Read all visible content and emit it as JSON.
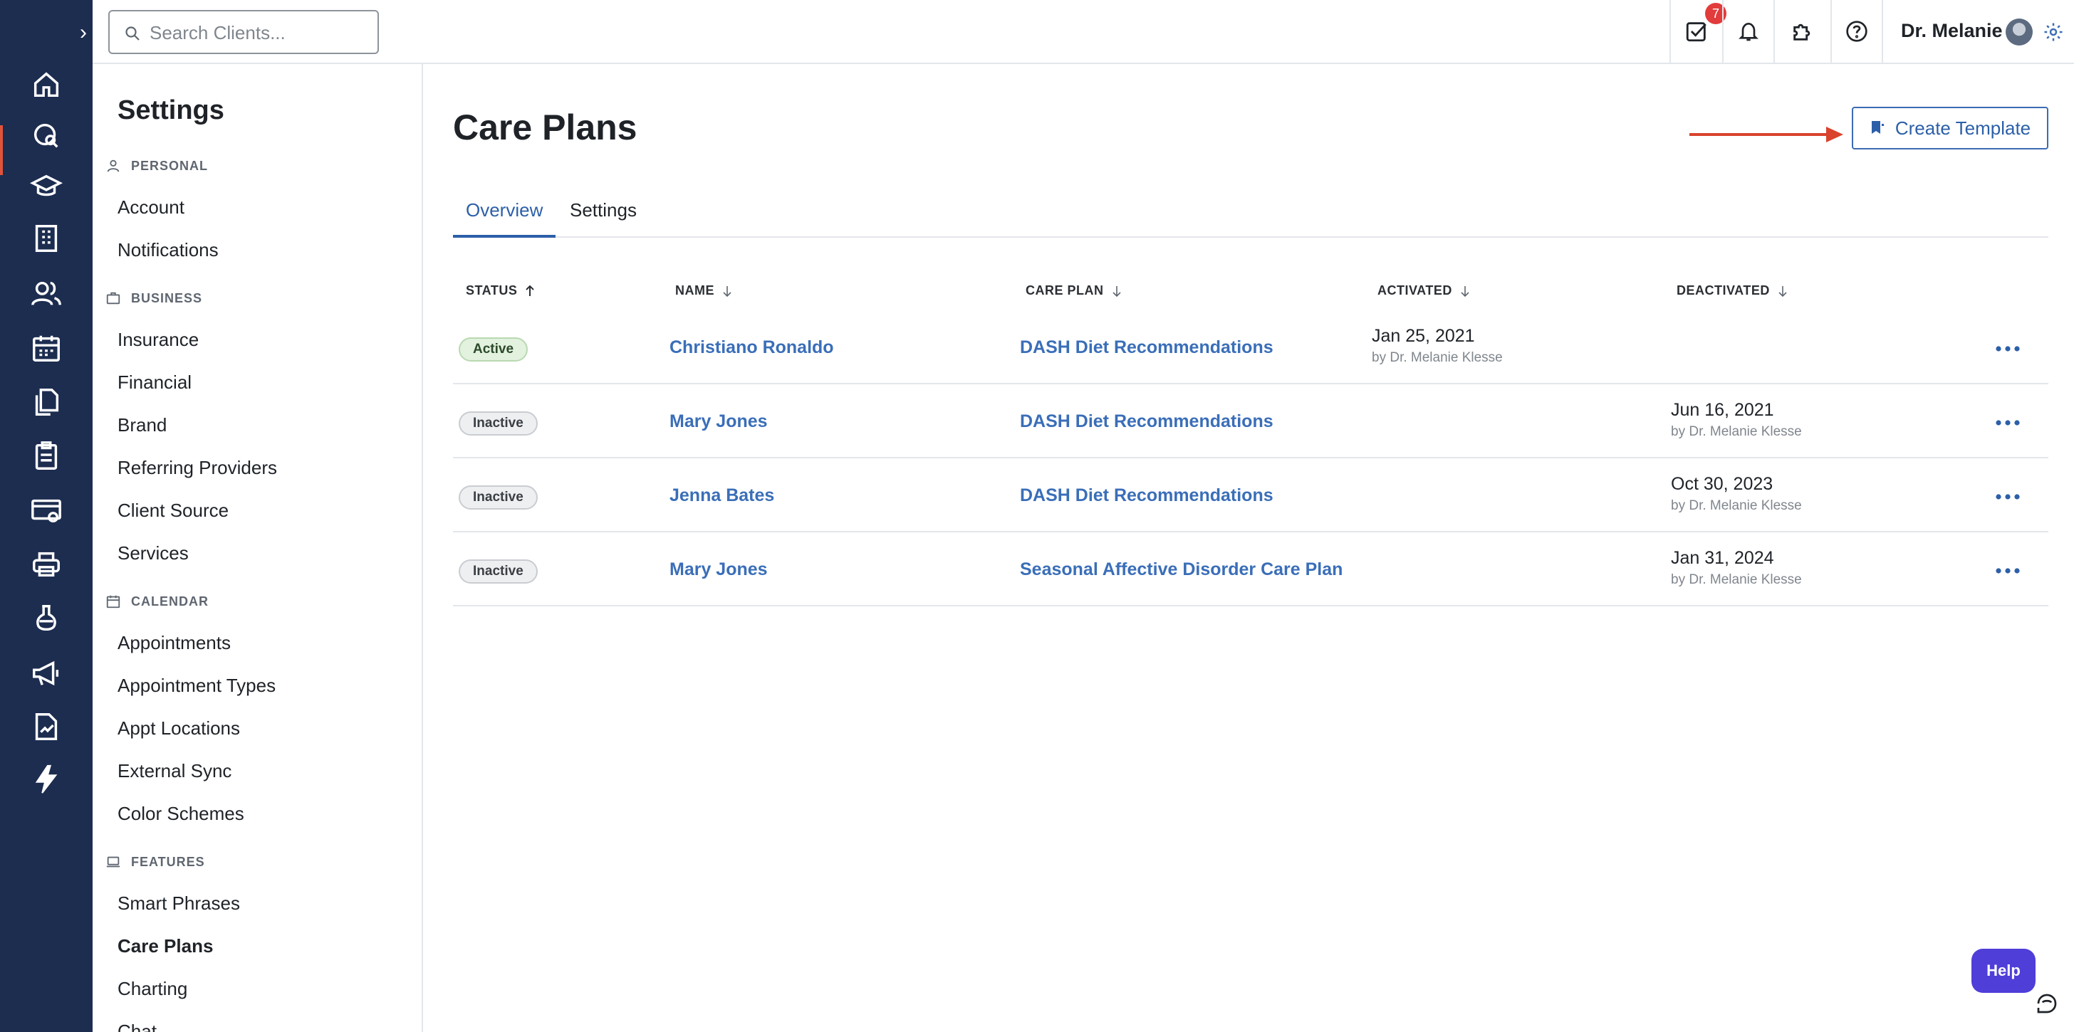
{
  "search": {
    "placeholder": "Search Clients..."
  },
  "topbar": {
    "task_badge_count": "7",
    "user_name": "Dr. Melanie"
  },
  "rail": {
    "icons": [
      "home-icon",
      "chat-search-icon",
      "education-icon",
      "building-icon",
      "clients-icon",
      "calendar-icon",
      "documents-icon",
      "clipboard-icon",
      "billing-icon",
      "print-icon",
      "lab-flask-icon",
      "megaphone-icon",
      "reports-icon",
      "lightning-icon"
    ]
  },
  "sidebar": {
    "title": "Settings",
    "sections": [
      {
        "label": "PERSONAL",
        "icon": "person-icon",
        "items": [
          "Account",
          "Notifications"
        ]
      },
      {
        "label": "BUSINESS",
        "icon": "briefcase-icon",
        "items": [
          "Insurance",
          "Financial",
          "Brand",
          "Referring Providers",
          "Client Source",
          "Services"
        ]
      },
      {
        "label": "CALENDAR",
        "icon": "calendar-icon",
        "items": [
          "Appointments",
          "Appointment Types",
          "Appt Locations",
          "External Sync",
          "Color Schemes"
        ]
      },
      {
        "label": "FEATURES",
        "icon": "laptop-icon",
        "items": [
          "Smart Phrases",
          "Care Plans",
          "Charting",
          "Chat"
        ]
      }
    ],
    "active_item": "Care Plans"
  },
  "main": {
    "title": "Care Plans",
    "create_button": "Create Template",
    "tabs": [
      {
        "label": "Overview",
        "active": true
      },
      {
        "label": "Settings",
        "active": false
      }
    ],
    "columns": [
      "STATUS",
      "NAME",
      "CARE PLAN",
      "ACTIVATED",
      "DEACTIVATED"
    ],
    "rows": [
      {
        "status": "Active",
        "name": "Christiano Ronaldo",
        "care_plan": "DASH Diet Recommendations",
        "activated": "Jan 25, 2021",
        "activated_by": "by Dr. Melanie Klesse",
        "deactivated": "",
        "deactivated_by": ""
      },
      {
        "status": "Inactive",
        "name": "Mary Jones",
        "care_plan": "DASH Diet Recommendations",
        "activated": "",
        "activated_by": "",
        "deactivated": "Jun 16, 2021",
        "deactivated_by": "by Dr. Melanie Klesse"
      },
      {
        "status": "Inactive",
        "name": "Jenna Bates",
        "care_plan": "DASH Diet Recommendations",
        "activated": "",
        "activated_by": "",
        "deactivated": "Oct 30, 2023",
        "deactivated_by": "by Dr. Melanie Klesse"
      },
      {
        "status": "Inactive",
        "name": "Mary Jones",
        "care_plan": "Seasonal Affective Disorder Care Plan",
        "activated": "",
        "activated_by": "",
        "deactivated": "Jan 31, 2024",
        "deactivated_by": "by Dr. Melanie Klesse"
      }
    ]
  },
  "help": {
    "label": "Help"
  },
  "colors": {
    "rail": "#1d2d50",
    "accent": "#2c5fa8",
    "arrow": "#d9422c",
    "help": "#4f3ed8",
    "badge": "#e23b3b"
  }
}
